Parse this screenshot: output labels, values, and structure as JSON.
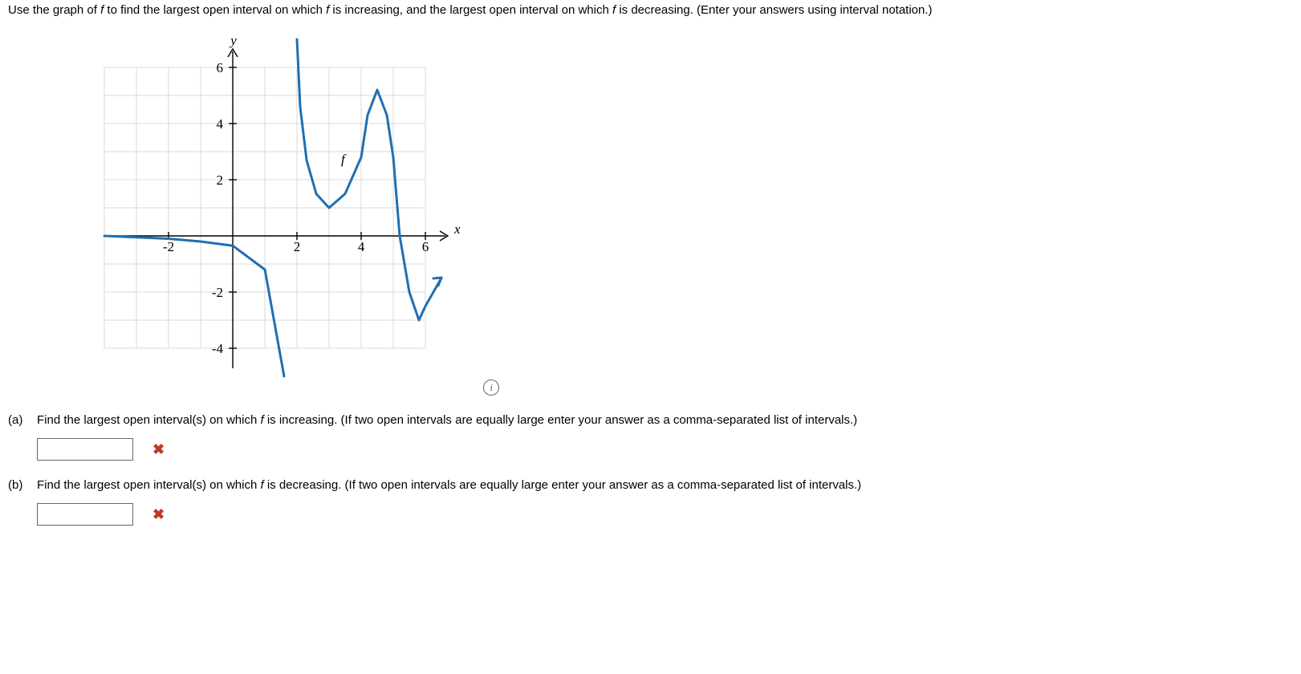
{
  "instruction_pre": "Use the graph of ",
  "instruction_mid1": " to find the largest open interval on which ",
  "instruction_mid2": " is increasing, and the largest open interval on which ",
  "instruction_post": " is decreasing. (Enter your answers using interval notation.)",
  "f_var": "f",
  "graph": {
    "yLabel": "y",
    "xLabel": "x",
    "fLabel": "f",
    "xTicks": [
      -2,
      2,
      4,
      6
    ],
    "yTicks": [
      6,
      4,
      2,
      -2,
      -4
    ]
  },
  "info_icon": "i",
  "partA": {
    "label": "(a)",
    "text_pre": "Find the largest open interval(s) on which ",
    "text_post": " is increasing. (If two open intervals are equally large enter your answer as a comma-separated list of intervals.)",
    "value": "",
    "mark": "✖"
  },
  "partB": {
    "label": "(b)",
    "text_pre": "Find the largest open interval(s) on which ",
    "text_post": " is decreasing. (If two open intervals are equally large enter your answer as a comma-separated list of intervals.)",
    "value": "",
    "mark": "✖"
  },
  "chart_data": {
    "type": "line",
    "title": "",
    "xlabel": "x",
    "ylabel": "y",
    "xlim": [
      -4,
      7
    ],
    "ylim": [
      -5,
      7
    ],
    "pieces": [
      {
        "name": "left-branch",
        "x": [
          -4,
          -3,
          -2,
          -1,
          0,
          1,
          1.6
        ],
        "y": [
          0.0,
          -0.05,
          -0.1,
          -0.2,
          -0.35,
          -1.2,
          -5.0
        ]
      },
      {
        "name": "mid-branch",
        "x": [
          2.0,
          2.1,
          2.3,
          2.6,
          3.0,
          3.5,
          4.0
        ],
        "y": [
          7.0,
          4.6,
          2.7,
          1.5,
          1.0,
          1.5,
          2.8
        ]
      },
      {
        "name": "peak",
        "x": [
          4.0,
          4.2,
          4.5,
          4.8,
          5.0
        ],
        "y": [
          2.8,
          4.3,
          5.2,
          4.3,
          2.8
        ]
      },
      {
        "name": "right-dip",
        "x": [
          5.0,
          5.2,
          5.5,
          5.8,
          6.0,
          6.5
        ],
        "y": [
          2.8,
          0.0,
          -2.0,
          -3.0,
          -2.5,
          -1.5
        ]
      }
    ]
  }
}
